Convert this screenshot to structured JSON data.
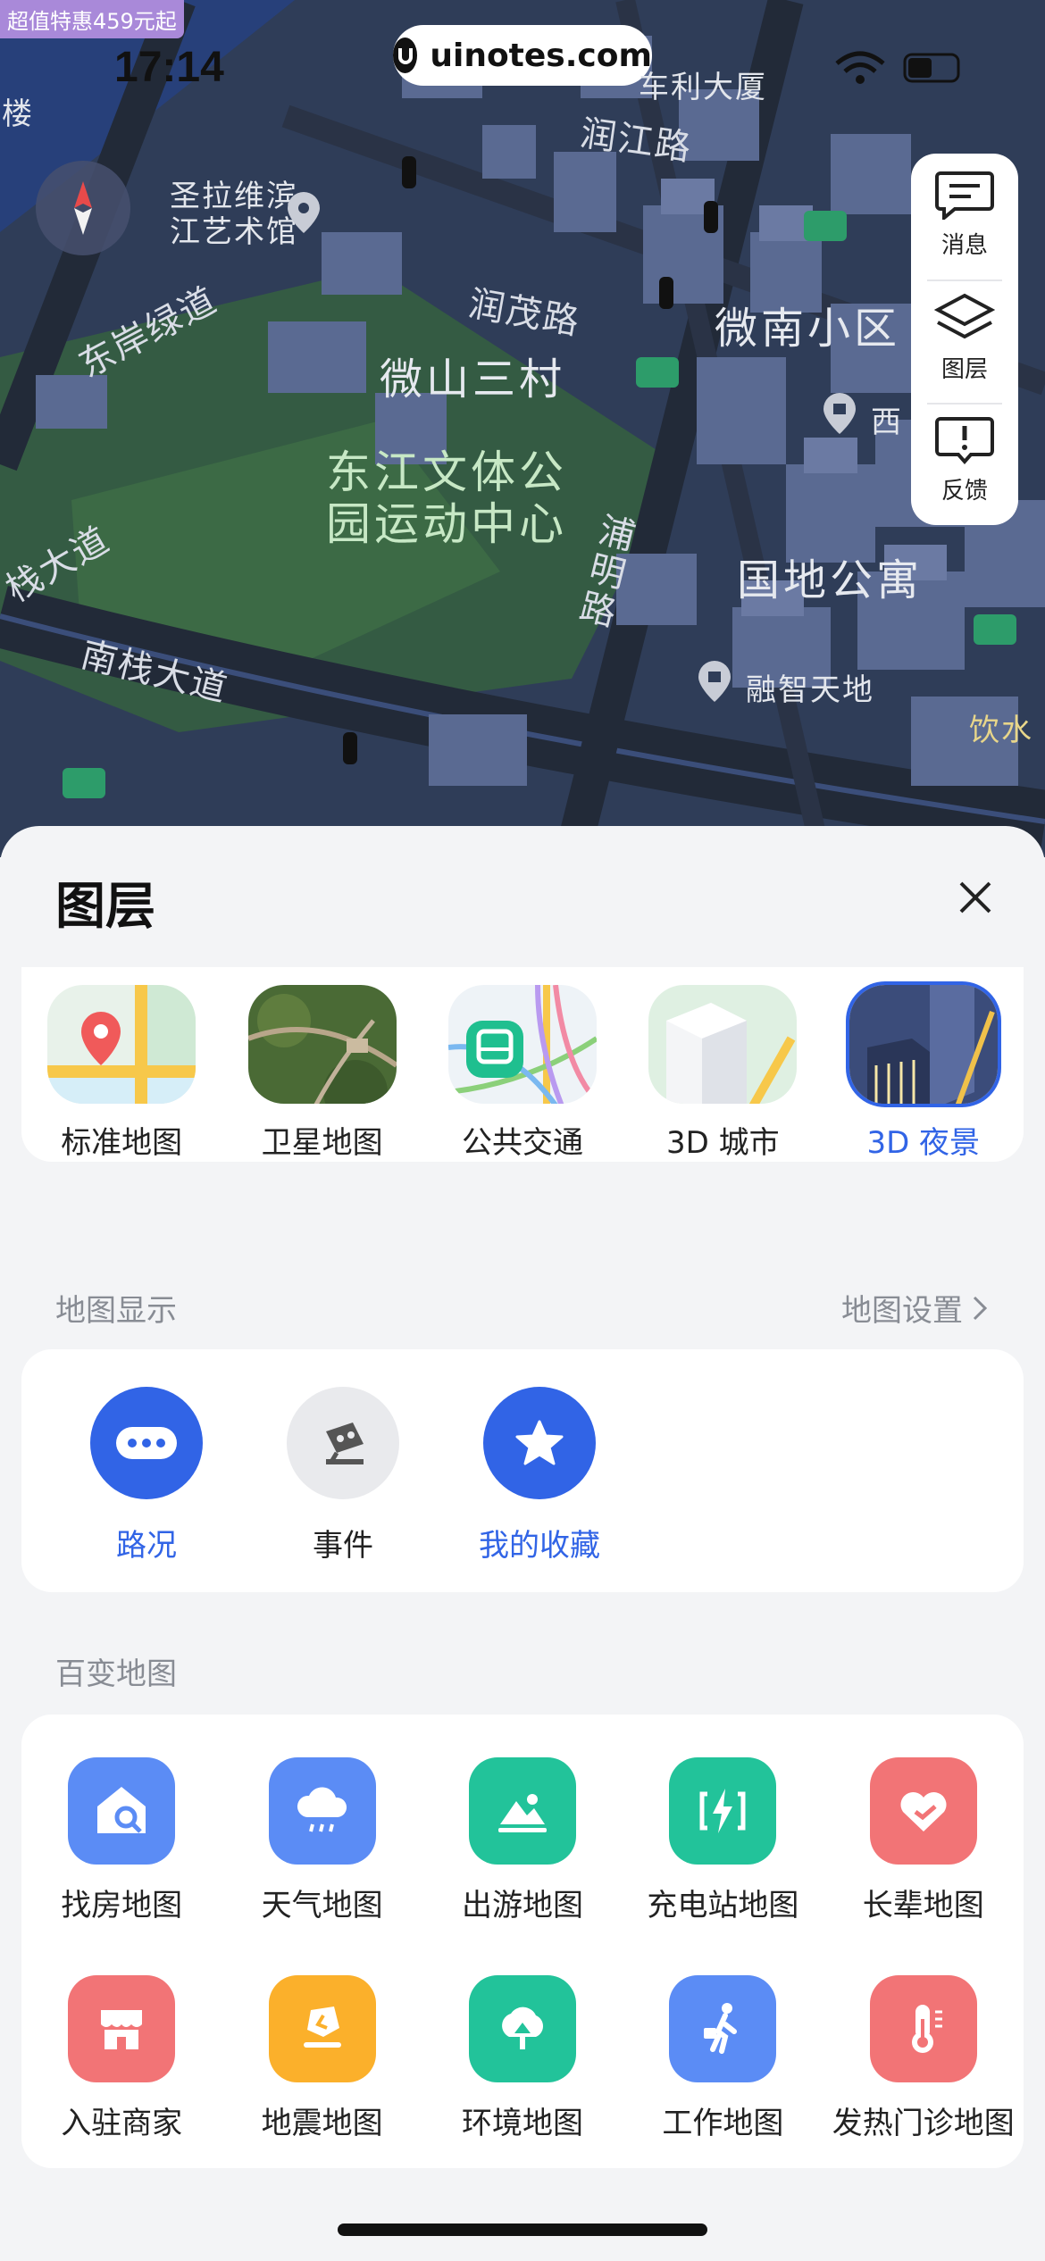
{
  "status": {
    "time": "17:14",
    "promo": "超值特惠459元起",
    "watermark": "uinotes.com"
  },
  "map": {
    "labels": {
      "building_top": "车利大厦",
      "road_runjiang": "润江路",
      "poi_art": "圣拉维滨\n江艺术馆",
      "road_east": "东岸绿道",
      "road_runmao": "润茂路",
      "area_weinan": "微南小区",
      "area_weishan": "微山三村",
      "park": "东江文体公\n园运动中心",
      "road_pu": "浦\n明\n路",
      "apartment": "国地公寓",
      "road_nanzhan": "南栈大道",
      "road_zhan": "栈大道",
      "rongzhi": "融智天地",
      "yinshui": "饮水",
      "xi": "西",
      "lou": "楼"
    },
    "tools": [
      {
        "label": "消息",
        "icon": "message-icon"
      },
      {
        "label": "图层",
        "icon": "layers-icon"
      },
      {
        "label": "反馈",
        "icon": "feedback-icon"
      }
    ]
  },
  "sheet": {
    "title": "图层",
    "layers": [
      {
        "label": "标准地图",
        "icon": "standard-map-thumb",
        "selected": false
      },
      {
        "label": "卫星地图",
        "icon": "satellite-map-thumb",
        "selected": false
      },
      {
        "label": "公共交通",
        "icon": "transit-map-thumb",
        "selected": false
      },
      {
        "label": "3D 城市",
        "icon": "3d-city-thumb",
        "selected": false
      },
      {
        "label": "3D 夜景",
        "icon": "3d-night-thumb",
        "selected": true
      }
    ],
    "display_section": {
      "title": "地图显示",
      "settings_link": "地图设置"
    },
    "display_items": [
      {
        "label": "路况",
        "icon": "traffic-icon",
        "active": true
      },
      {
        "label": "事件",
        "icon": "event-icon",
        "active": false
      },
      {
        "label": "我的收藏",
        "icon": "favorites-icon",
        "active": true
      }
    ],
    "baibian_section": {
      "title": "百变地图"
    },
    "baibian_items": [
      {
        "label": "找房地图",
        "icon": "house-search-icon",
        "color": "#5b8cf5"
      },
      {
        "label": "天气地图",
        "icon": "weather-icon",
        "color": "#5b8cf5"
      },
      {
        "label": "出游地图",
        "icon": "travel-icon",
        "color": "#22c39a"
      },
      {
        "label": "充电站地图",
        "icon": "charging-icon",
        "color": "#22c39a"
      },
      {
        "label": "长辈地图",
        "icon": "elder-icon",
        "color": "#f27476"
      },
      {
        "label": "入驻商家",
        "icon": "merchant-icon",
        "color": "#f27476"
      },
      {
        "label": "地震地图",
        "icon": "earthquake-icon",
        "color": "#fbb02b"
      },
      {
        "label": "环境地图",
        "icon": "environment-icon",
        "color": "#22c39a"
      },
      {
        "label": "工作地图",
        "icon": "work-icon",
        "color": "#5b8cf5"
      },
      {
        "label": "发热门诊地图",
        "icon": "fever-clinic-icon",
        "color": "#f27476"
      }
    ]
  },
  "colors": {
    "accent": "#3164e6",
    "map_bg": "#2f3d58",
    "park": "#3c6a45"
  }
}
